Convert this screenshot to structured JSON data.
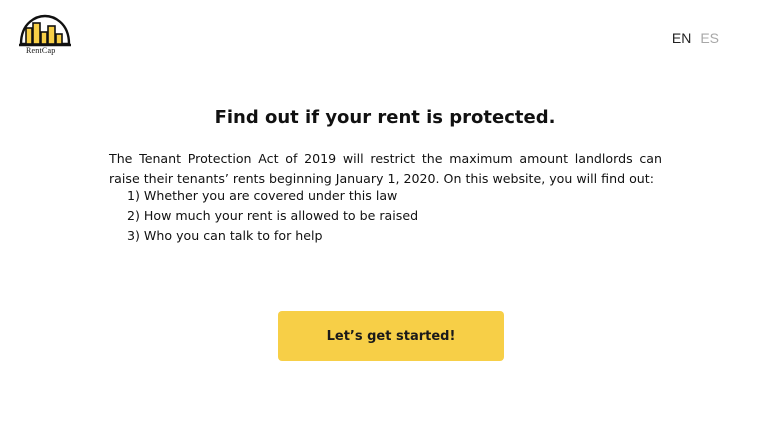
{
  "header": {
    "logo_name": "building-logo-icon",
    "logo_text": "RentCap",
    "languages": [
      {
        "label": "EN",
        "active": true
      },
      {
        "label": "ES",
        "active": false
      }
    ]
  },
  "main": {
    "title": "Find out if your rent is protected.",
    "intro": "The Tenant Protection Act of 2019 will restrict the maximum amount landlords can raise their tenants’ rents beginning January 1, 2020. On this website, you will find out:",
    "steps": [
      "1) Whether you are covered under this law",
      "2) How much your rent is allowed to be raised",
      "3) Who you can talk to for help"
    ],
    "cta_label": "Let’s get started!"
  },
  "colors": {
    "accent": "#f7cf47",
    "inactive_lang": "#a8a8a8",
    "text": "#111111"
  }
}
